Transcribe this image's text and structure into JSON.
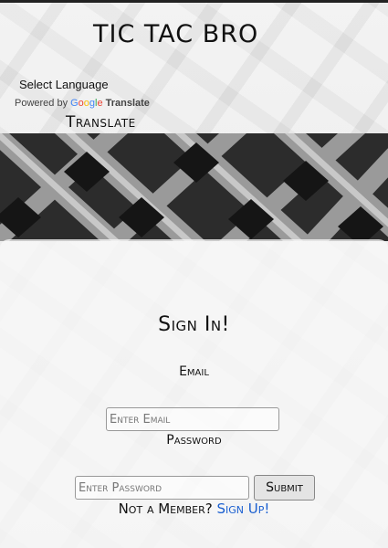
{
  "header": {
    "site_title": "TIC TAC BRO",
    "select_language": "Select Language",
    "powered_by": "Powered by",
    "google_logo": [
      "G",
      "o",
      "o",
      "g",
      "l",
      "e"
    ],
    "google_translate": "Translate",
    "translate_label": "Translate"
  },
  "banner": {
    "image_name": "building-facade-image"
  },
  "signin": {
    "title": "Sign In!",
    "email_label": "Email",
    "email_placeholder": "Enter Email",
    "email_value": "",
    "password_label": "Password",
    "password_placeholder": "Enter Password",
    "password_value": "",
    "submit_label": "Submit",
    "member_prompt": "Not a Member? ",
    "signup_link": "Sign Up!"
  },
  "colors": {
    "link": "#1a5fd0",
    "text": "#111111"
  }
}
